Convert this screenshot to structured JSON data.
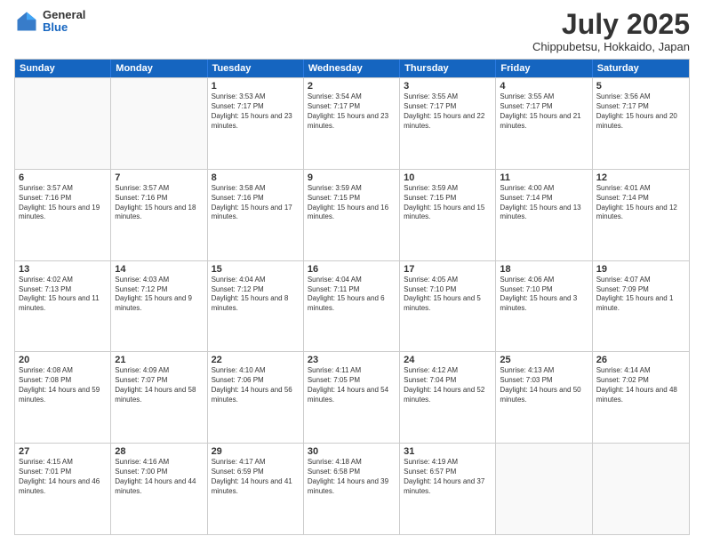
{
  "logo": {
    "general": "General",
    "blue": "Blue"
  },
  "title": "July 2025",
  "subtitle": "Chippubetsu, Hokkaido, Japan",
  "header": {
    "days": [
      "Sunday",
      "Monday",
      "Tuesday",
      "Wednesday",
      "Thursday",
      "Friday",
      "Saturday"
    ]
  },
  "weeks": [
    [
      {
        "day": "",
        "empty": true
      },
      {
        "day": "",
        "empty": true
      },
      {
        "day": "1",
        "sunrise": "Sunrise: 3:53 AM",
        "sunset": "Sunset: 7:17 PM",
        "daylight": "Daylight: 15 hours and 23 minutes."
      },
      {
        "day": "2",
        "sunrise": "Sunrise: 3:54 AM",
        "sunset": "Sunset: 7:17 PM",
        "daylight": "Daylight: 15 hours and 23 minutes."
      },
      {
        "day": "3",
        "sunrise": "Sunrise: 3:55 AM",
        "sunset": "Sunset: 7:17 PM",
        "daylight": "Daylight: 15 hours and 22 minutes."
      },
      {
        "day": "4",
        "sunrise": "Sunrise: 3:55 AM",
        "sunset": "Sunset: 7:17 PM",
        "daylight": "Daylight: 15 hours and 21 minutes."
      },
      {
        "day": "5",
        "sunrise": "Sunrise: 3:56 AM",
        "sunset": "Sunset: 7:17 PM",
        "daylight": "Daylight: 15 hours and 20 minutes."
      }
    ],
    [
      {
        "day": "6",
        "sunrise": "Sunrise: 3:57 AM",
        "sunset": "Sunset: 7:16 PM",
        "daylight": "Daylight: 15 hours and 19 minutes."
      },
      {
        "day": "7",
        "sunrise": "Sunrise: 3:57 AM",
        "sunset": "Sunset: 7:16 PM",
        "daylight": "Daylight: 15 hours and 18 minutes."
      },
      {
        "day": "8",
        "sunrise": "Sunrise: 3:58 AM",
        "sunset": "Sunset: 7:16 PM",
        "daylight": "Daylight: 15 hours and 17 minutes."
      },
      {
        "day": "9",
        "sunrise": "Sunrise: 3:59 AM",
        "sunset": "Sunset: 7:15 PM",
        "daylight": "Daylight: 15 hours and 16 minutes."
      },
      {
        "day": "10",
        "sunrise": "Sunrise: 3:59 AM",
        "sunset": "Sunset: 7:15 PM",
        "daylight": "Daylight: 15 hours and 15 minutes."
      },
      {
        "day": "11",
        "sunrise": "Sunrise: 4:00 AM",
        "sunset": "Sunset: 7:14 PM",
        "daylight": "Daylight: 15 hours and 13 minutes."
      },
      {
        "day": "12",
        "sunrise": "Sunrise: 4:01 AM",
        "sunset": "Sunset: 7:14 PM",
        "daylight": "Daylight: 15 hours and 12 minutes."
      }
    ],
    [
      {
        "day": "13",
        "sunrise": "Sunrise: 4:02 AM",
        "sunset": "Sunset: 7:13 PM",
        "daylight": "Daylight: 15 hours and 11 minutes."
      },
      {
        "day": "14",
        "sunrise": "Sunrise: 4:03 AM",
        "sunset": "Sunset: 7:12 PM",
        "daylight": "Daylight: 15 hours and 9 minutes."
      },
      {
        "day": "15",
        "sunrise": "Sunrise: 4:04 AM",
        "sunset": "Sunset: 7:12 PM",
        "daylight": "Daylight: 15 hours and 8 minutes."
      },
      {
        "day": "16",
        "sunrise": "Sunrise: 4:04 AM",
        "sunset": "Sunset: 7:11 PM",
        "daylight": "Daylight: 15 hours and 6 minutes."
      },
      {
        "day": "17",
        "sunrise": "Sunrise: 4:05 AM",
        "sunset": "Sunset: 7:10 PM",
        "daylight": "Daylight: 15 hours and 5 minutes."
      },
      {
        "day": "18",
        "sunrise": "Sunrise: 4:06 AM",
        "sunset": "Sunset: 7:10 PM",
        "daylight": "Daylight: 15 hours and 3 minutes."
      },
      {
        "day": "19",
        "sunrise": "Sunrise: 4:07 AM",
        "sunset": "Sunset: 7:09 PM",
        "daylight": "Daylight: 15 hours and 1 minute."
      }
    ],
    [
      {
        "day": "20",
        "sunrise": "Sunrise: 4:08 AM",
        "sunset": "Sunset: 7:08 PM",
        "daylight": "Daylight: 14 hours and 59 minutes."
      },
      {
        "day": "21",
        "sunrise": "Sunrise: 4:09 AM",
        "sunset": "Sunset: 7:07 PM",
        "daylight": "Daylight: 14 hours and 58 minutes."
      },
      {
        "day": "22",
        "sunrise": "Sunrise: 4:10 AM",
        "sunset": "Sunset: 7:06 PM",
        "daylight": "Daylight: 14 hours and 56 minutes."
      },
      {
        "day": "23",
        "sunrise": "Sunrise: 4:11 AM",
        "sunset": "Sunset: 7:05 PM",
        "daylight": "Daylight: 14 hours and 54 minutes."
      },
      {
        "day": "24",
        "sunrise": "Sunrise: 4:12 AM",
        "sunset": "Sunset: 7:04 PM",
        "daylight": "Daylight: 14 hours and 52 minutes."
      },
      {
        "day": "25",
        "sunrise": "Sunrise: 4:13 AM",
        "sunset": "Sunset: 7:03 PM",
        "daylight": "Daylight: 14 hours and 50 minutes."
      },
      {
        "day": "26",
        "sunrise": "Sunrise: 4:14 AM",
        "sunset": "Sunset: 7:02 PM",
        "daylight": "Daylight: 14 hours and 48 minutes."
      }
    ],
    [
      {
        "day": "27",
        "sunrise": "Sunrise: 4:15 AM",
        "sunset": "Sunset: 7:01 PM",
        "daylight": "Daylight: 14 hours and 46 minutes."
      },
      {
        "day": "28",
        "sunrise": "Sunrise: 4:16 AM",
        "sunset": "Sunset: 7:00 PM",
        "daylight": "Daylight: 14 hours and 44 minutes."
      },
      {
        "day": "29",
        "sunrise": "Sunrise: 4:17 AM",
        "sunset": "Sunset: 6:59 PM",
        "daylight": "Daylight: 14 hours and 41 minutes."
      },
      {
        "day": "30",
        "sunrise": "Sunrise: 4:18 AM",
        "sunset": "Sunset: 6:58 PM",
        "daylight": "Daylight: 14 hours and 39 minutes."
      },
      {
        "day": "31",
        "sunrise": "Sunrise: 4:19 AM",
        "sunset": "Sunset: 6:57 PM",
        "daylight": "Daylight: 14 hours and 37 minutes."
      },
      {
        "day": "",
        "empty": true
      },
      {
        "day": "",
        "empty": true
      }
    ]
  ]
}
